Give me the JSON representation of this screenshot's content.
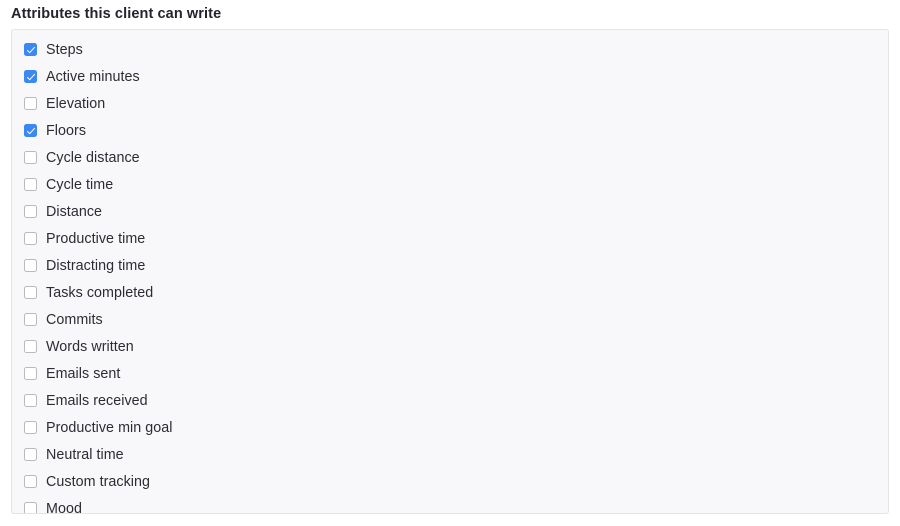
{
  "section": {
    "title": "Attributes this client can write"
  },
  "colors": {
    "checkbox_checked": "#3b88f2",
    "checkbox_border": "#b9b9c2",
    "panel_background": "#f8f8fa",
    "panel_border": "#e3e3e9",
    "text": "#2c2c34",
    "title_text": "#24242c",
    "page_background": "#ffffff"
  },
  "attributes": [
    {
      "label": "Steps",
      "checked": true
    },
    {
      "label": "Active minutes",
      "checked": true
    },
    {
      "label": "Elevation",
      "checked": false
    },
    {
      "label": "Floors",
      "checked": true
    },
    {
      "label": "Cycle distance",
      "checked": false
    },
    {
      "label": "Cycle time",
      "checked": false
    },
    {
      "label": "Distance",
      "checked": false
    },
    {
      "label": "Productive time",
      "checked": false
    },
    {
      "label": "Distracting time",
      "checked": false
    },
    {
      "label": "Tasks completed",
      "checked": false
    },
    {
      "label": "Commits",
      "checked": false
    },
    {
      "label": "Words written",
      "checked": false
    },
    {
      "label": "Emails sent",
      "checked": false
    },
    {
      "label": "Emails received",
      "checked": false
    },
    {
      "label": "Productive min goal",
      "checked": false
    },
    {
      "label": "Neutral time",
      "checked": false
    },
    {
      "label": "Custom tracking",
      "checked": false
    },
    {
      "label": "Mood",
      "checked": false
    }
  ]
}
